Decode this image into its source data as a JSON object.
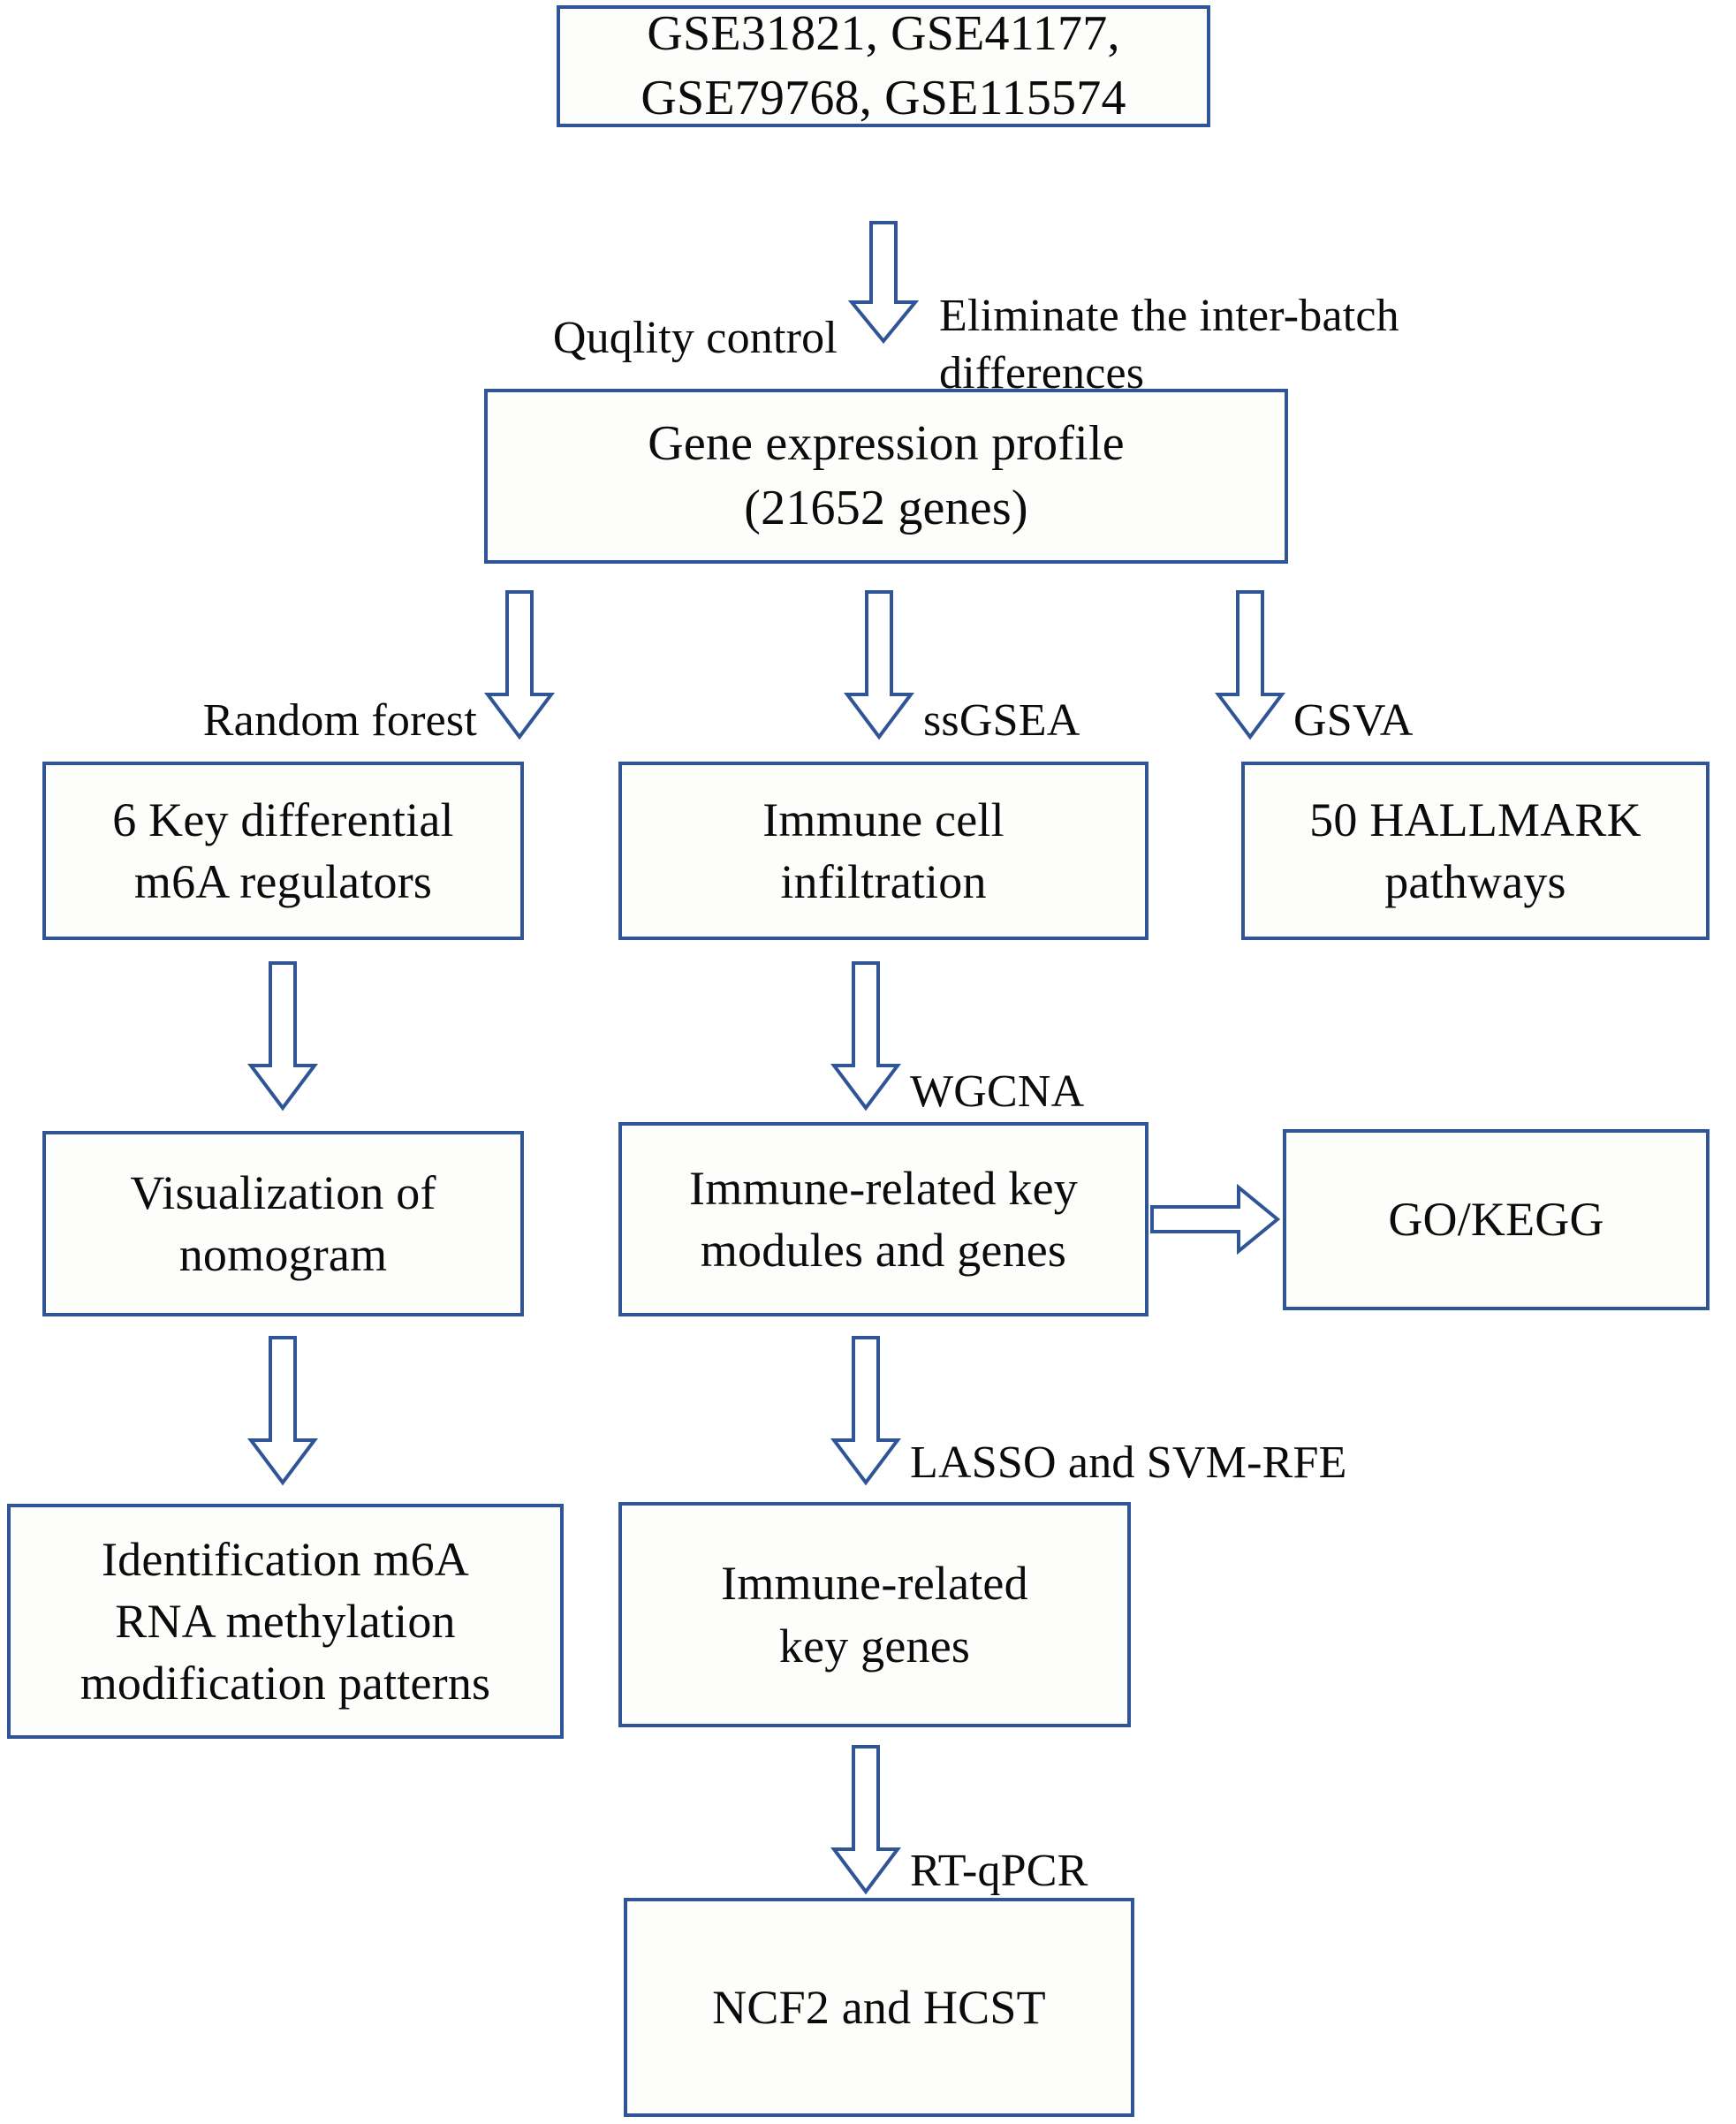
{
  "figure": {
    "type": "flowchart",
    "orientation": "top-to-bottom",
    "accent_color": "#2f5597",
    "text_color": "#0b0b0b",
    "background_color": "#ffffff"
  },
  "nodes": {
    "datasets": "GSE31821, GSE41177,\nGSE79768, GSE115574",
    "gene_profile": "Gene expression profile\n(21652 genes)",
    "m6a_regulators": "6 Key differential\nm6A regulators",
    "immune_infiltration": "Immune cell\ninfiltration",
    "hallmark_pathways": "50 HALLMARK\npathways",
    "nomogram": "Visualization of\nnomogram",
    "key_modules": "Immune-related key\nmodules and genes",
    "go_kegg": "GO/KEGG",
    "m6a_patterns": "Identification m6A\nRNA methylation\nmodification patterns",
    "key_genes": "Immune-related\nkey genes",
    "final_genes": "NCF2 and HCST"
  },
  "edge_labels": {
    "quality_control": "Quqlity control",
    "inter_batch": "Eliminate the inter-batch\ndifferences",
    "random_forest": "Random forest",
    "ssgsea": "ssGSEA",
    "gsva": "GSVA",
    "wgcna": "WGCNA",
    "lasso_svmrfe": "LASSO and SVM-RFE",
    "rt_qpcr": "RT-qPCR"
  },
  "edges": [
    {
      "from": "datasets",
      "to": "gene_profile",
      "labels": [
        "quality_control",
        "inter_batch"
      ],
      "direction": "down"
    },
    {
      "from": "gene_profile",
      "to": "m6a_regulators",
      "labels": [
        "random_forest"
      ],
      "direction": "down"
    },
    {
      "from": "gene_profile",
      "to": "immune_infiltration",
      "labels": [
        "ssgsea"
      ],
      "direction": "down"
    },
    {
      "from": "gene_profile",
      "to": "hallmark_pathways",
      "labels": [
        "gsva"
      ],
      "direction": "down"
    },
    {
      "from": "m6a_regulators",
      "to": "nomogram",
      "labels": [],
      "direction": "down"
    },
    {
      "from": "immune_infiltration",
      "to": "key_modules",
      "labels": [
        "wgcna"
      ],
      "direction": "down"
    },
    {
      "from": "key_modules",
      "to": "go_kegg",
      "labels": [],
      "direction": "right"
    },
    {
      "from": "nomogram",
      "to": "m6a_patterns",
      "labels": [],
      "direction": "down"
    },
    {
      "from": "key_modules",
      "to": "key_genes",
      "labels": [
        "lasso_svmrfe"
      ],
      "direction": "down"
    },
    {
      "from": "key_genes",
      "to": "final_genes",
      "labels": [
        "rt_qpcr"
      ],
      "direction": "down"
    }
  ]
}
